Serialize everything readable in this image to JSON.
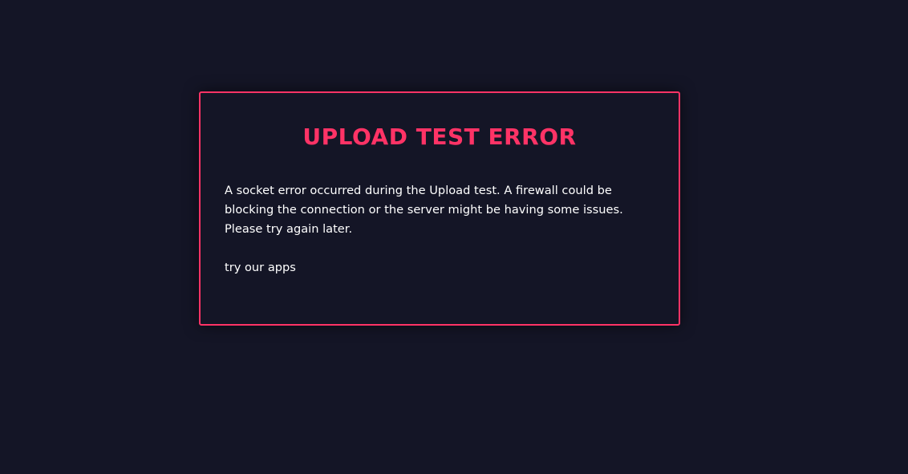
{
  "dialog": {
    "title": "UPLOAD TEST ERROR",
    "message": "A socket error occurred during the Upload test. A firewall could be blocking the connection or the server might be having some issues. Please try again later.",
    "apps_link": "try our apps"
  },
  "colors": {
    "background": "#141526",
    "accent": "#ff3366",
    "text": "#ffffff"
  }
}
